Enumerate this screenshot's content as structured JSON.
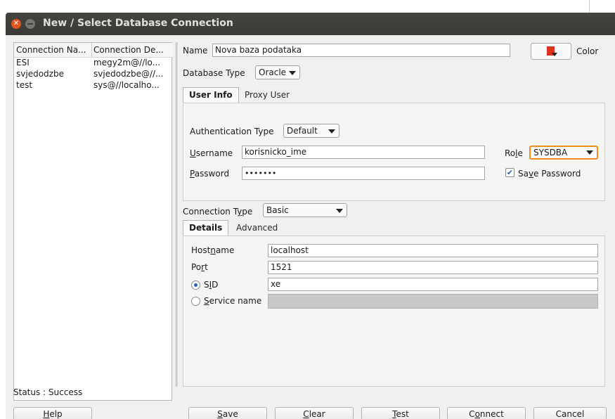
{
  "window": {
    "title": "New / Select Database Connection"
  },
  "connections": {
    "columns": [
      "Connection Na...",
      "Connection De..."
    ],
    "rows": [
      {
        "name": "ESI",
        "details": "megy2m@//lo..."
      },
      {
        "name": "svjedodzbe",
        "details": "svjedodzbe@//..."
      },
      {
        "name": "test",
        "details": "sys@//localho..."
      }
    ]
  },
  "status": "Status : Success",
  "form": {
    "name_label": "Name",
    "name_value": "Nova baza podataka",
    "color_label": "Color",
    "db_type_label": "Database Type",
    "db_type_value": "Oracle",
    "tabs": [
      "User Info",
      "Proxy User"
    ],
    "auth_type_label": "Authentication Type",
    "auth_type_value": "Default",
    "username_label_pre": "",
    "username_label_key": "U",
    "username_label_post": "sername",
    "username_value": "korisnicko_ime",
    "password_label_key": "P",
    "password_label_post": "assword",
    "password_value": "•••••••",
    "role_label_pre": "Ro",
    "role_label_key": "l",
    "role_label_post": "e",
    "role_value": "SYSDBA",
    "save_password_pre": "Sa",
    "save_password_key": "v",
    "save_password_post": "e Password",
    "save_password_checked": true,
    "conn_type_pre": "Connection T",
    "conn_type_key": "y",
    "conn_type_post": "pe",
    "conn_type_value": "Basic",
    "detail_tabs": [
      "Details",
      "Advanced"
    ],
    "hostname_pre": "Host",
    "hostname_key": "n",
    "hostname_post": "ame",
    "hostname_value": "localhost",
    "port_pre": "Po",
    "port_key": "r",
    "port_post": "t",
    "port_value": "1521",
    "sid_pre": "S",
    "sid_key": "I",
    "sid_post": "D",
    "sid_value": "xe",
    "service_pre": "",
    "service_key": "S",
    "service_post": "ervice name"
  },
  "buttons": {
    "help_key": "H",
    "help_post": "elp",
    "save_key": "S",
    "save_post": "ave",
    "clear_key": "C",
    "clear_post": "lear",
    "test_key": "T",
    "test_post": "est",
    "connect_pre": "C",
    "connect_key": "o",
    "connect_post": "nnect",
    "cancel": "Cancel"
  },
  "colors": {
    "title_bg": "#3e3d39",
    "close_btn": "#e2541e",
    "role_highlight": "#f08c1e",
    "color_swatch": "#e0301e"
  }
}
